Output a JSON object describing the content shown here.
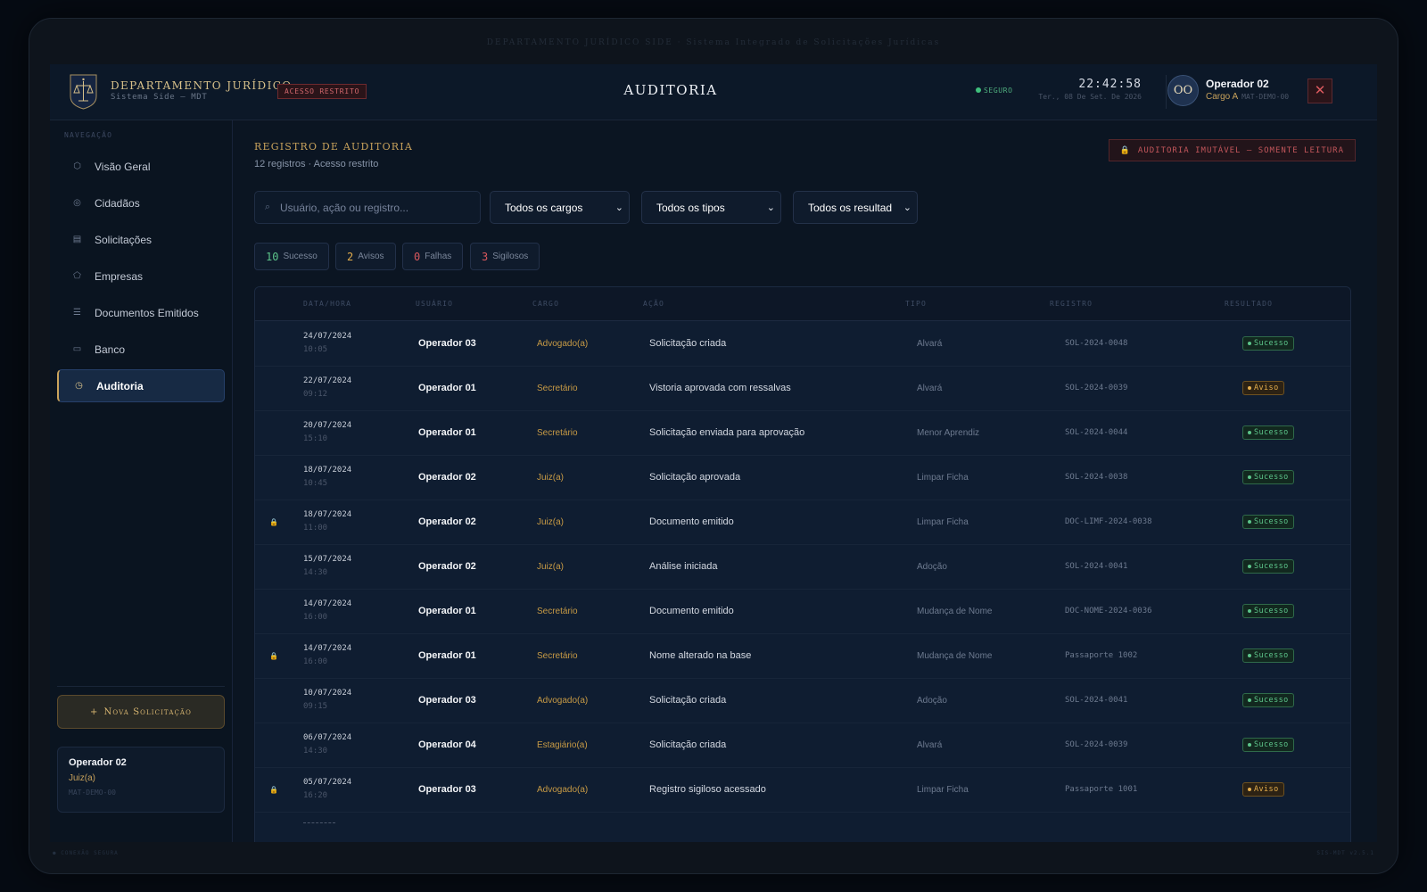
{
  "device": {
    "top_text": "DEPARTAMENTO JURÍDICO SIDE · Sistema Integrado de Solicitações Jurídicas",
    "bottom_left": "● CONEXÃO SEGURA",
    "bottom_right": "SIS-MDT v2.5.1"
  },
  "header": {
    "brand_title": "DEPARTAMENTO JURÍDICO",
    "brand_sub": "Sistema Side — MDT",
    "restricted": "ACESSO RESTRITO",
    "page_title": "AUDITORIA",
    "secure": "SEGURO",
    "time": "22:42:58",
    "date": "Ter., 08 De Set. De 2026",
    "avatar": "OO",
    "user_name": "Operador 02",
    "user_role": "Cargo A",
    "user_mat": "MAT-DEMO-00",
    "close": "✕"
  },
  "sidebar": {
    "nav_label": "NAVEGAÇÃO",
    "items": [
      {
        "label": "Visão Geral",
        "icon": "⬡"
      },
      {
        "label": "Cidadãos",
        "icon": "◎"
      },
      {
        "label": "Solicitações",
        "icon": "▤"
      },
      {
        "label": "Empresas",
        "icon": "⬠"
      },
      {
        "label": "Documentos Emitidos",
        "icon": "☰"
      },
      {
        "label": "Banco",
        "icon": "▭"
      },
      {
        "label": "Auditoria",
        "icon": "◷"
      }
    ],
    "new_request": "Nova Solicitação",
    "new_request_icon": "+",
    "user": {
      "name": "Operador 02",
      "role": "Juiz(a)",
      "mat": "MAT-DEMO-00"
    }
  },
  "main": {
    "title": "REGISTRO DE AUDITORIA",
    "subtitle": "12 registros · Acesso restrito",
    "immutable": "AUDITORIA IMUTÁVEL — SOMENTE LEITURA",
    "search_placeholder": "Usuário, ação ou registro...",
    "filters": [
      "Todos os cargos",
      "Todos os tipos",
      "Todos os resultad"
    ],
    "stats": [
      {
        "num": "10",
        "label": "Sucesso",
        "color": "#5cc48a"
      },
      {
        "num": "2",
        "label": "Avisos",
        "color": "#e3ad4c"
      },
      {
        "num": "0",
        "label": "Falhas",
        "color": "#d9585d"
      },
      {
        "num": "3",
        "label": "Sigilosos",
        "color": "#d9585d"
      }
    ],
    "columns": [
      "DATA/HORA",
      "USUÁRIO",
      "CARGO",
      "AÇÃO",
      "TIPO",
      "REGISTRO",
      "RESULTADO"
    ],
    "rows": [
      {
        "date": "24/07/2024",
        "time": "10:05",
        "user": "Operador 03",
        "cargo": "Advogado(a)",
        "acao": "Solicitação criada",
        "tipo": "Alvará",
        "registro": "SOL-2024-0048",
        "resultado": "Sucesso",
        "status": "ok",
        "locked": false
      },
      {
        "date": "22/07/2024",
        "time": "09:12",
        "user": "Operador 01",
        "cargo": "Secretário",
        "acao": "Vistoria aprovada com ressalvas",
        "tipo": "Alvará",
        "registro": "SOL-2024-0039",
        "resultado": "Aviso",
        "status": "warn",
        "locked": false
      },
      {
        "date": "20/07/2024",
        "time": "15:10",
        "user": "Operador 01",
        "cargo": "Secretário",
        "acao": "Solicitação enviada para aprovação",
        "tipo": "Menor Aprendiz",
        "registro": "SOL-2024-0044",
        "resultado": "Sucesso",
        "status": "ok",
        "locked": false
      },
      {
        "date": "18/07/2024",
        "time": "10:45",
        "user": "Operador 02",
        "cargo": "Juiz(a)",
        "acao": "Solicitação aprovada",
        "tipo": "Limpar Ficha",
        "registro": "SOL-2024-0038",
        "resultado": "Sucesso",
        "status": "ok",
        "locked": false
      },
      {
        "date": "18/07/2024",
        "time": "11:00",
        "user": "Operador 02",
        "cargo": "Juiz(a)",
        "acao": "Documento emitido",
        "tipo": "Limpar Ficha",
        "registro": "DOC-LIMF-2024-0038",
        "resultado": "Sucesso",
        "status": "ok",
        "locked": true
      },
      {
        "date": "15/07/2024",
        "time": "14:30",
        "user": "Operador 02",
        "cargo": "Juiz(a)",
        "acao": "Análise iniciada",
        "tipo": "Adoção",
        "registro": "SOL-2024-0041",
        "resultado": "Sucesso",
        "status": "ok",
        "locked": false
      },
      {
        "date": "14/07/2024",
        "time": "16:00",
        "user": "Operador 01",
        "cargo": "Secretário",
        "acao": "Documento emitido",
        "tipo": "Mudança de Nome",
        "registro": "DOC-NOME-2024-0036",
        "resultado": "Sucesso",
        "status": "ok",
        "locked": false
      },
      {
        "date": "14/07/2024",
        "time": "16:00",
        "user": "Operador 01",
        "cargo": "Secretário",
        "acao": "Nome alterado na base",
        "tipo": "Mudança de Nome",
        "registro": "Passaporte 1002",
        "resultado": "Sucesso",
        "status": "ok",
        "locked": true
      },
      {
        "date": "10/07/2024",
        "time": "09:15",
        "user": "Operador 03",
        "cargo": "Advogado(a)",
        "acao": "Solicitação criada",
        "tipo": "Adoção",
        "registro": "SOL-2024-0041",
        "resultado": "Sucesso",
        "status": "ok",
        "locked": false
      },
      {
        "date": "06/07/2024",
        "time": "14:30",
        "user": "Operador 04",
        "cargo": "Estagiário(a)",
        "acao": "Solicitação criada",
        "tipo": "Alvará",
        "registro": "SOL-2024-0039",
        "resultado": "Sucesso",
        "status": "ok",
        "locked": false
      },
      {
        "date": "05/07/2024",
        "time": "16:20",
        "user": "Operador 03",
        "cargo": "Advogado(a)",
        "acao": "Registro sigiloso acessado",
        "tipo": "Limpar Ficha",
        "registro": "Passaporte 1001",
        "resultado": "Aviso",
        "status": "warn",
        "locked": true
      }
    ]
  }
}
